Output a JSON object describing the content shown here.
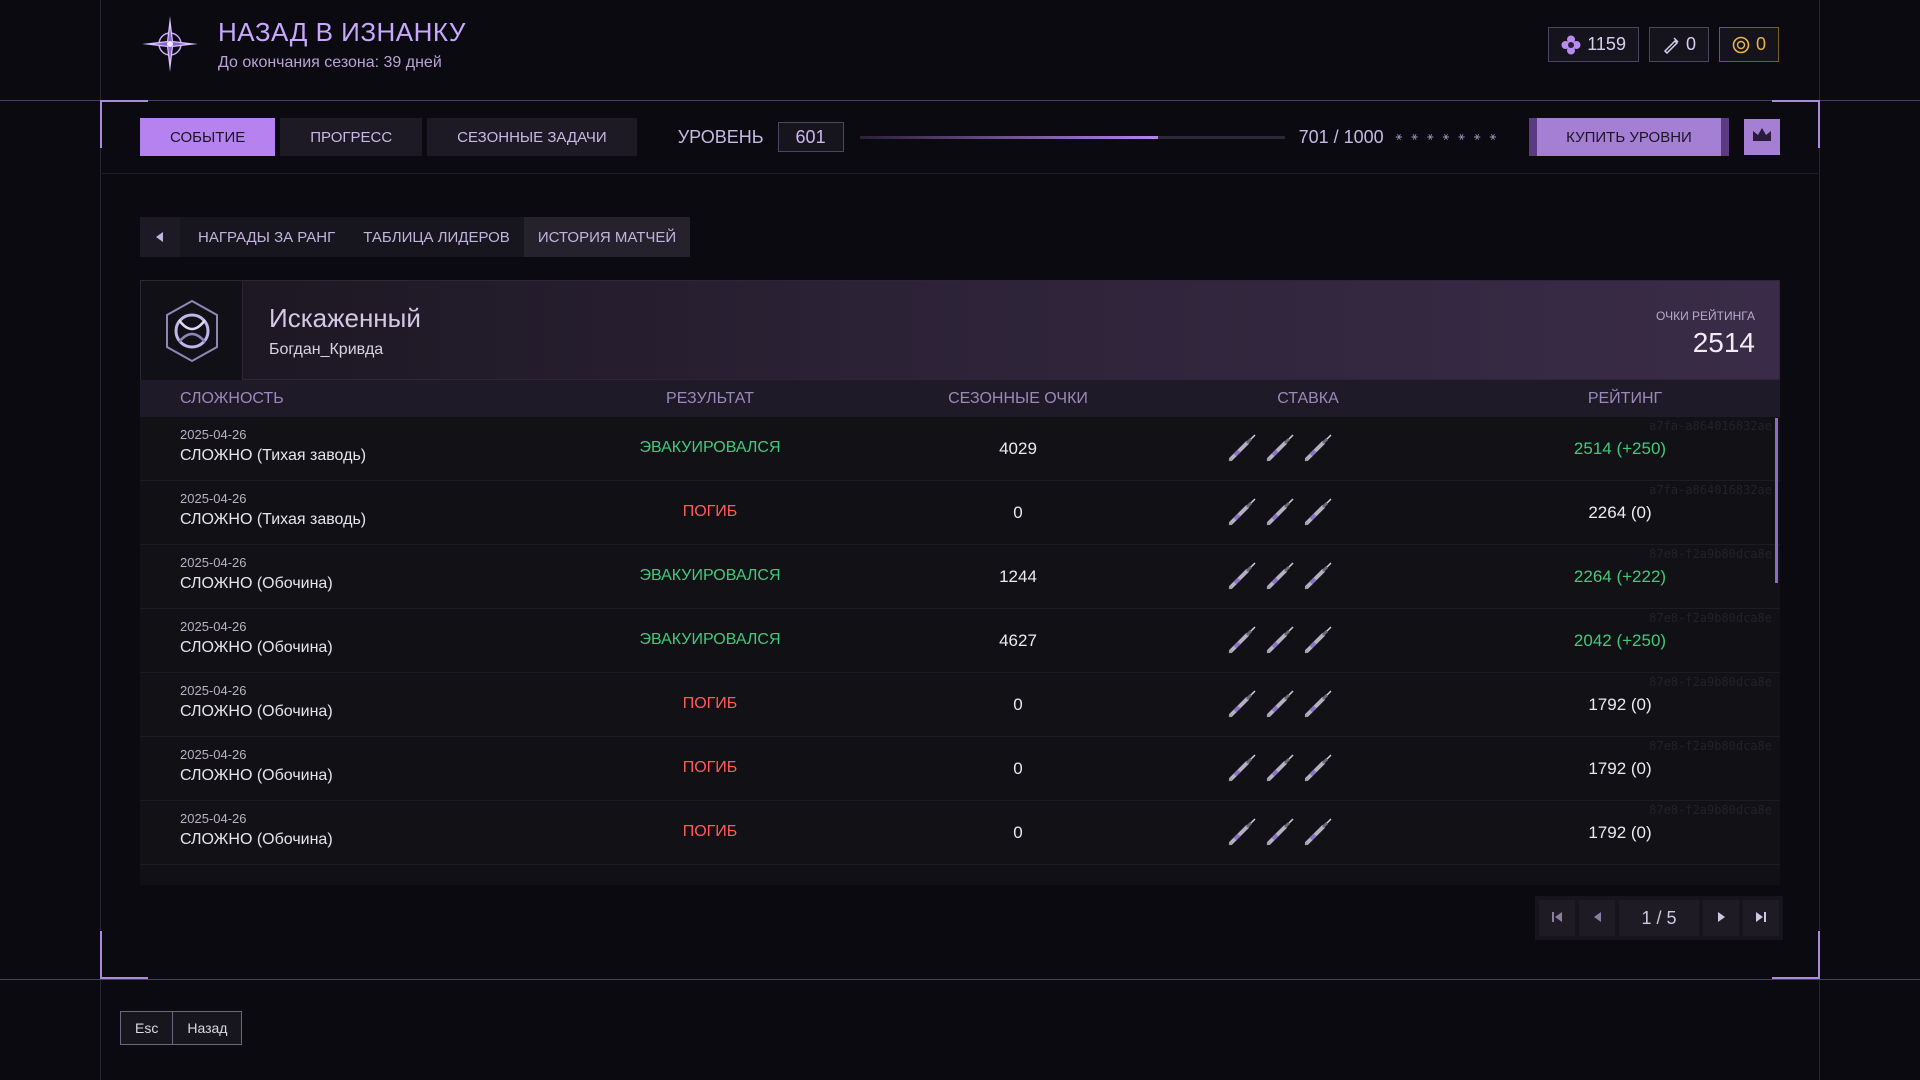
{
  "header": {
    "title": "НАЗАД В ИЗНАНКУ",
    "subtitle": "До окончания сезона: 39 дней"
  },
  "currencies": [
    {
      "icon": "flower-icon",
      "value": "1159"
    },
    {
      "icon": "syringe-ticket-icon",
      "value": "0"
    },
    {
      "icon": "gold-coin-icon",
      "value": "0"
    }
  ],
  "nav": {
    "tabs": [
      "СОБЫТИЕ",
      "ПРОГРЕСС",
      "СЕЗОННЫЕ ЗАДАЧИ"
    ],
    "active_tab": 0,
    "level_label": "УРОВЕНЬ",
    "level_value": "601",
    "xp_text": "701 / 1000",
    "xp_fraction": 0.701,
    "stars": "⚹ ⚹ ⚹ ⚹ ⚹ ⚹ ⚹",
    "buy_label": "КУПИТЬ УРОВНИ",
    "crown_icon": "crown-icon"
  },
  "subtabs": {
    "items": [
      "НАГРАДЫ ЗА РАНГ",
      "ТАБЛИЦА ЛИДЕРОВ",
      "ИСТОРИЯ МАТЧЕЙ"
    ],
    "active": 2
  },
  "profile": {
    "rank": "Искаженный",
    "name": "Богдан_Кривда",
    "rating_label": "ОЧКИ РЕЙТИНГА",
    "rating_value": "2514"
  },
  "table": {
    "headers": {
      "difficulty": "СЛОЖНОСТЬ",
      "result": "РЕЗУЛЬТАТ",
      "points": "СЕЗОННЫЕ ОЧКИ",
      "stake": "СТАВКА",
      "rating": "РЕЙТИНГ"
    },
    "rows": [
      {
        "date": "2025-04-26",
        "mode": "СЛОЖНО (Тихая заводь)",
        "result": "ЭВАКУИРОВАЛСЯ",
        "result_type": "ok",
        "points": "4029",
        "rating": "2514 (+250)",
        "rating_up": true,
        "hash": "a7fa-a864016832ae"
      },
      {
        "date": "2025-04-26",
        "mode": "СЛОЖНО (Тихая заводь)",
        "result": "ПОГИБ",
        "result_type": "dead",
        "points": "0",
        "rating": "2264 (0)",
        "rating_up": false,
        "hash": "a7fa-a864016832ae"
      },
      {
        "date": "2025-04-26",
        "mode": "СЛОЖНО (Обочина)",
        "result": "ЭВАКУИРОВАЛСЯ",
        "result_type": "ok",
        "points": "1244",
        "rating": "2264 (+222)",
        "rating_up": true,
        "hash": "87e8-f2a9b80dca8e"
      },
      {
        "date": "2025-04-26",
        "mode": "СЛОЖНО (Обочина)",
        "result": "ЭВАКУИРОВАЛСЯ",
        "result_type": "ok",
        "points": "4627",
        "rating": "2042 (+250)",
        "rating_up": true,
        "hash": "87e8-f2a9b80dca8e"
      },
      {
        "date": "2025-04-26",
        "mode": "СЛОЖНО (Обочина)",
        "result": "ПОГИБ",
        "result_type": "dead",
        "points": "0",
        "rating": "1792 (0)",
        "rating_up": false,
        "hash": "87e8-f2a9b80dca8e"
      },
      {
        "date": "2025-04-26",
        "mode": "СЛОЖНО (Обочина)",
        "result": "ПОГИБ",
        "result_type": "dead",
        "points": "0",
        "rating": "1792 (0)",
        "rating_up": false,
        "hash": "87e8-f2a9b80dca8e"
      },
      {
        "date": "2025-04-26",
        "mode": "СЛОЖНО (Обочина)",
        "result": "ПОГИБ",
        "result_type": "dead",
        "points": "0",
        "rating": "1792 (0)",
        "rating_up": false,
        "hash": "87e8-f2a9b80dca8e"
      }
    ],
    "stake_icon": "syringe-icon",
    "stake_count": 3
  },
  "pager": {
    "label": "1 / 5"
  },
  "footer": {
    "esc": "Esc",
    "back": "Назад"
  }
}
